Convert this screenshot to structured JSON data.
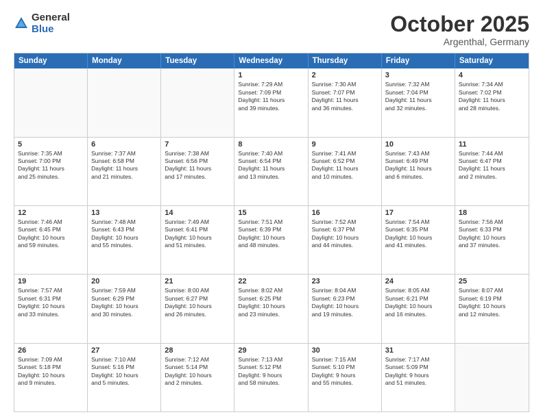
{
  "logo": {
    "general": "General",
    "blue": "Blue"
  },
  "header": {
    "month": "October 2025",
    "location": "Argenthal, Germany"
  },
  "days": [
    "Sunday",
    "Monday",
    "Tuesday",
    "Wednesday",
    "Thursday",
    "Friday",
    "Saturday"
  ],
  "rows": [
    [
      {
        "day": "",
        "text": ""
      },
      {
        "day": "",
        "text": ""
      },
      {
        "day": "",
        "text": ""
      },
      {
        "day": "1",
        "text": "Sunrise: 7:29 AM\nSunset: 7:09 PM\nDaylight: 11 hours\nand 39 minutes."
      },
      {
        "day": "2",
        "text": "Sunrise: 7:30 AM\nSunset: 7:07 PM\nDaylight: 11 hours\nand 36 minutes."
      },
      {
        "day": "3",
        "text": "Sunrise: 7:32 AM\nSunset: 7:04 PM\nDaylight: 11 hours\nand 32 minutes."
      },
      {
        "day": "4",
        "text": "Sunrise: 7:34 AM\nSunset: 7:02 PM\nDaylight: 11 hours\nand 28 minutes."
      }
    ],
    [
      {
        "day": "5",
        "text": "Sunrise: 7:35 AM\nSunset: 7:00 PM\nDaylight: 11 hours\nand 25 minutes."
      },
      {
        "day": "6",
        "text": "Sunrise: 7:37 AM\nSunset: 6:58 PM\nDaylight: 11 hours\nand 21 minutes."
      },
      {
        "day": "7",
        "text": "Sunrise: 7:38 AM\nSunset: 6:56 PM\nDaylight: 11 hours\nand 17 minutes."
      },
      {
        "day": "8",
        "text": "Sunrise: 7:40 AM\nSunset: 6:54 PM\nDaylight: 11 hours\nand 13 minutes."
      },
      {
        "day": "9",
        "text": "Sunrise: 7:41 AM\nSunset: 6:52 PM\nDaylight: 11 hours\nand 10 minutes."
      },
      {
        "day": "10",
        "text": "Sunrise: 7:43 AM\nSunset: 6:49 PM\nDaylight: 11 hours\nand 6 minutes."
      },
      {
        "day": "11",
        "text": "Sunrise: 7:44 AM\nSunset: 6:47 PM\nDaylight: 11 hours\nand 2 minutes."
      }
    ],
    [
      {
        "day": "12",
        "text": "Sunrise: 7:46 AM\nSunset: 6:45 PM\nDaylight: 10 hours\nand 59 minutes."
      },
      {
        "day": "13",
        "text": "Sunrise: 7:48 AM\nSunset: 6:43 PM\nDaylight: 10 hours\nand 55 minutes."
      },
      {
        "day": "14",
        "text": "Sunrise: 7:49 AM\nSunset: 6:41 PM\nDaylight: 10 hours\nand 51 minutes."
      },
      {
        "day": "15",
        "text": "Sunrise: 7:51 AM\nSunset: 6:39 PM\nDaylight: 10 hours\nand 48 minutes."
      },
      {
        "day": "16",
        "text": "Sunrise: 7:52 AM\nSunset: 6:37 PM\nDaylight: 10 hours\nand 44 minutes."
      },
      {
        "day": "17",
        "text": "Sunrise: 7:54 AM\nSunset: 6:35 PM\nDaylight: 10 hours\nand 41 minutes."
      },
      {
        "day": "18",
        "text": "Sunrise: 7:56 AM\nSunset: 6:33 PM\nDaylight: 10 hours\nand 37 minutes."
      }
    ],
    [
      {
        "day": "19",
        "text": "Sunrise: 7:57 AM\nSunset: 6:31 PM\nDaylight: 10 hours\nand 33 minutes."
      },
      {
        "day": "20",
        "text": "Sunrise: 7:59 AM\nSunset: 6:29 PM\nDaylight: 10 hours\nand 30 minutes."
      },
      {
        "day": "21",
        "text": "Sunrise: 8:00 AM\nSunset: 6:27 PM\nDaylight: 10 hours\nand 26 minutes."
      },
      {
        "day": "22",
        "text": "Sunrise: 8:02 AM\nSunset: 6:25 PM\nDaylight: 10 hours\nand 23 minutes."
      },
      {
        "day": "23",
        "text": "Sunrise: 8:04 AM\nSunset: 6:23 PM\nDaylight: 10 hours\nand 19 minutes."
      },
      {
        "day": "24",
        "text": "Sunrise: 8:05 AM\nSunset: 6:21 PM\nDaylight: 10 hours\nand 16 minutes."
      },
      {
        "day": "25",
        "text": "Sunrise: 8:07 AM\nSunset: 6:19 PM\nDaylight: 10 hours\nand 12 minutes."
      }
    ],
    [
      {
        "day": "26",
        "text": "Sunrise: 7:09 AM\nSunset: 5:18 PM\nDaylight: 10 hours\nand 9 minutes."
      },
      {
        "day": "27",
        "text": "Sunrise: 7:10 AM\nSunset: 5:16 PM\nDaylight: 10 hours\nand 5 minutes."
      },
      {
        "day": "28",
        "text": "Sunrise: 7:12 AM\nSunset: 5:14 PM\nDaylight: 10 hours\nand 2 minutes."
      },
      {
        "day": "29",
        "text": "Sunrise: 7:13 AM\nSunset: 5:12 PM\nDaylight: 9 hours\nand 58 minutes."
      },
      {
        "day": "30",
        "text": "Sunrise: 7:15 AM\nSunset: 5:10 PM\nDaylight: 9 hours\nand 55 minutes."
      },
      {
        "day": "31",
        "text": "Sunrise: 7:17 AM\nSunset: 5:09 PM\nDaylight: 9 hours\nand 51 minutes."
      },
      {
        "day": "",
        "text": ""
      }
    ]
  ]
}
